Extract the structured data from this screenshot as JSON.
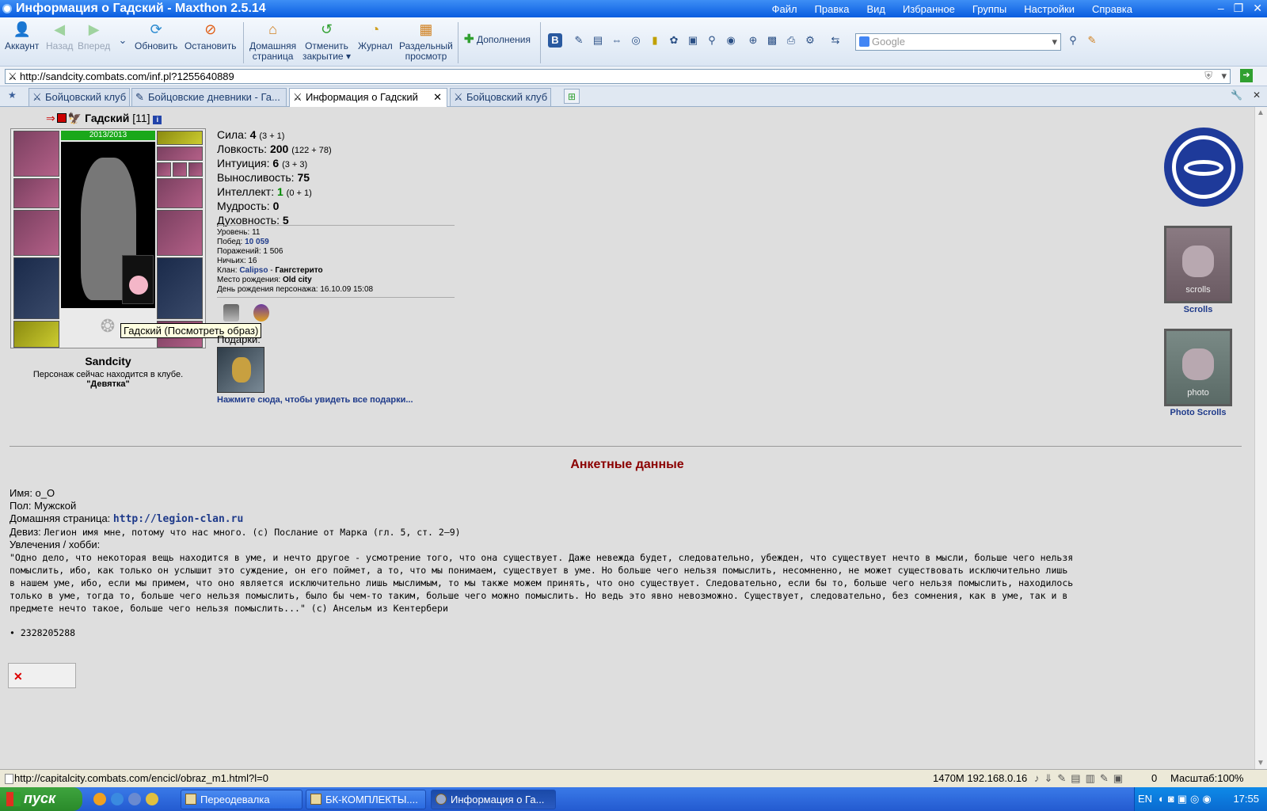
{
  "window": {
    "title": "Информация о Гадский - Maxthon 2.5.14",
    "menu": [
      "Файл",
      "Правка",
      "Вид",
      "Избранное",
      "Группы",
      "Настройки",
      "Справка"
    ]
  },
  "toolbar": {
    "account": "Аккаунт",
    "back": "Назад",
    "forward": "Вперед",
    "refresh": "Обновить",
    "stop": "Остановить",
    "home_line1": "Домашняя",
    "home_line2": "страница",
    "undo_line1": "Отменить",
    "undo_line2": "закрытие",
    "journal": "Журнал",
    "split_line1": "Раздельный",
    "split_line2": "просмотр",
    "addons": "Дополнения",
    "search_placeholder": "Google"
  },
  "address": {
    "url": "http://sandcity.combats.com/inf.pl?1255640889"
  },
  "tabs": [
    {
      "label": "Бойцовский клуб",
      "active": false
    },
    {
      "label": "Бойцовские дневники - Га...",
      "active": false
    },
    {
      "label": "Информация о Гадский",
      "active": true
    },
    {
      "label": "Бойцовский клуб",
      "active": false
    }
  ],
  "character": {
    "name": "Гадский",
    "level_text": "[11]",
    "hp": "2013/2013",
    "city": "Sandcity",
    "location_line": "Персонаж сейчас находится в клубе.",
    "room": "\"Девятка\"",
    "tooltip": "Гадский (Посмотреть образ)"
  },
  "stats": [
    {
      "label": "Сила:",
      "value": "4",
      "extra": "(3 + 1)"
    },
    {
      "label": "Ловкость:",
      "value": "200",
      "extra": "(122 + 78)"
    },
    {
      "label": "Интуиция:",
      "value": "6",
      "extra": "(3 + 3)"
    },
    {
      "label": "Выносливость:",
      "value": "75",
      "extra": ""
    },
    {
      "label": "Интеллект:",
      "value": "1",
      "extra": "(0 + 1)"
    },
    {
      "label": "Мудрость:",
      "value": "0",
      "extra": ""
    },
    {
      "label": "Духовность:",
      "value": "5",
      "extra": ""
    }
  ],
  "info": {
    "level": "Уровень: 11",
    "wins_label": "Побед:",
    "wins": "10 059",
    "losses": "Поражений: 1 506",
    "draws": "Ничьих: 16",
    "clan_label": "Клан:",
    "clan": "Calipso",
    "clan_sep": " - ",
    "clan_rank": "Гангстерито",
    "birthplace_label": "Место рождения:",
    "birthplace": "Old city",
    "birthday": "День рождения персонажа: 16.10.09 15:08"
  },
  "gifts": {
    "label": "Подарки:",
    "link": "Нажмите сюда, чтобы увидеть все подарки..."
  },
  "sidebar": {
    "scrolls": "Scrolls",
    "scrolls_img": "scrolls",
    "photo_scrolls": "Photo Scrolls",
    "photo_img": "photo"
  },
  "profile": {
    "heading": "Анкетные данные",
    "name": "Имя: o_O",
    "gender": "Пол: Мужской",
    "homepage_label": "Домашняя страница:",
    "homepage": "http://legion-clan.ru",
    "motto_label": "Девиз:",
    "motto": "Легион имя мне, потому что нас много. (с) Послание от Марка (гл. 5, ст. 2—9)",
    "hobby_label": "Увлечения / хобби:",
    "hobby_lines": [
      "\"Одно дело, что некоторая вещь находится в уме, и нечто другое - усмотрение того, что она существует. Даже невежда будет, следовательно, убежден, что существует нечто в мысли, больше чего нельзя",
      "помыслить, ибо, как только он услышит это суждение, он его поймет, а то, что мы понимаем, существует в уме. Но больше чего нельзя помыслить, несомненно, не может существовать исключительно лишь",
      "в нашем уме, ибо, если мы примем, что оно является исключительно лишь мыслимым, то мы также можем принять, что оно существует. Следовательно, если бы то, больше чего нельзя помыслить, находилось",
      "только в уме, тогда то, больше чего нельзя помыслить, было бы чем-то таким, больше чего можно помыслить. Но ведь это явно невозможно. Существует, следовательно, без сомнения, как в уме, так и в",
      "предмете нечто такое, больше чего нельзя помыслить...\" (с) Ансельм из Кентербери"
    ],
    "icq": "• 2328205288"
  },
  "status": {
    "url": "http://capitalcity.combats.com/encicl/obraz_m1.html?l=0",
    "mem": "1470M 192.168.0.16",
    "zero": "0",
    "zoom": "Масштаб:100%"
  },
  "taskbar": {
    "start": "пуск",
    "tasks": [
      "Переодевалка",
      "БК-КОМПЛЕКТЫ....",
      "Информация о Га..."
    ],
    "lang": "EN",
    "clock": "17:55"
  }
}
